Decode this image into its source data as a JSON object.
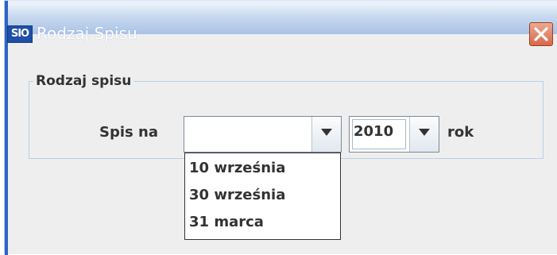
{
  "window": {
    "app_icon_text": "SIO",
    "title": "Rodzaj Spisu",
    "close_icon": "close-icon"
  },
  "group": {
    "title": "Rodzaj spisu"
  },
  "form": {
    "spis_label": "Spis na",
    "date_combo_value": "",
    "year_combo_value": "2010",
    "year_suffix": "rok",
    "dropdown_icon": "chevron-down-icon"
  },
  "dropdown": {
    "options": [
      "10 września",
      "30 września",
      "31 marca"
    ]
  },
  "colors": {
    "titlebar_top": "#eaf1fa",
    "titlebar_bottom": "#a9c3e6",
    "close_button": "#d9694a",
    "panel_bg": "#eeeeee",
    "groupbox_border": "#b8cfe5"
  }
}
